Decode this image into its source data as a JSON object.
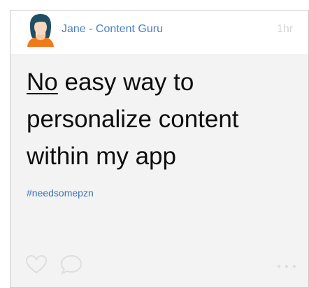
{
  "post": {
    "author": "Jane - Content Guru",
    "time": "1hr",
    "title_underlined": "No",
    "title_rest": " easy way to personalize content within my app",
    "hashtag": "#needsomepzn"
  },
  "icons": {
    "avatar": "user-avatar-icon",
    "like": "heart-icon",
    "comment": "comment-bubble-icon",
    "more": "more-dots-icon"
  },
  "colors": {
    "author_link": "#4a80c2",
    "hashtag_link": "#3a72b5",
    "timestamp": "#d4d4d4",
    "card_bg": "#f3f3f3",
    "icon_stroke": "#dedede",
    "avatar_orange": "#f07a1a"
  }
}
